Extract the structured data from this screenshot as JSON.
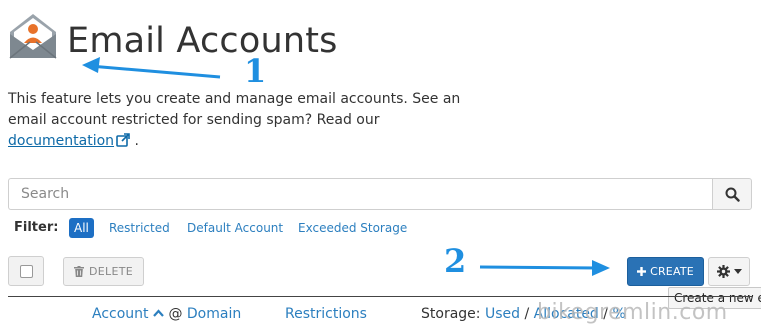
{
  "header": {
    "title": "Email Accounts",
    "intro_text": "This feature lets you create and manage email accounts. See an email account restricted for sending spam? Read our",
    "intro_link": "documentation",
    "intro_end": "."
  },
  "annotations": {
    "one": "1",
    "two": "2"
  },
  "search": {
    "placeholder": "Search"
  },
  "filter": {
    "label": "Filter:",
    "options": [
      "All",
      "Restricted",
      "Default Account",
      "Exceeded Storage"
    ],
    "active": "All"
  },
  "toolbar": {
    "delete_label": "DELETE",
    "create_label": "CREATE",
    "create_tooltip": "Create a new email account"
  },
  "columns": {
    "account": "Account",
    "at": "@",
    "domain": "Domain",
    "restrictions": "Restrictions",
    "storage_label": "Storage:",
    "storage_used": "Used",
    "separator": "/",
    "storage_allocated": "Allocated",
    "storage_percent": "%"
  },
  "watermark": "bikegremlin.com",
  "colors": {
    "accent": "#2a72b5",
    "link": "#2c7fbf",
    "annotation": "#1f8fe0"
  }
}
